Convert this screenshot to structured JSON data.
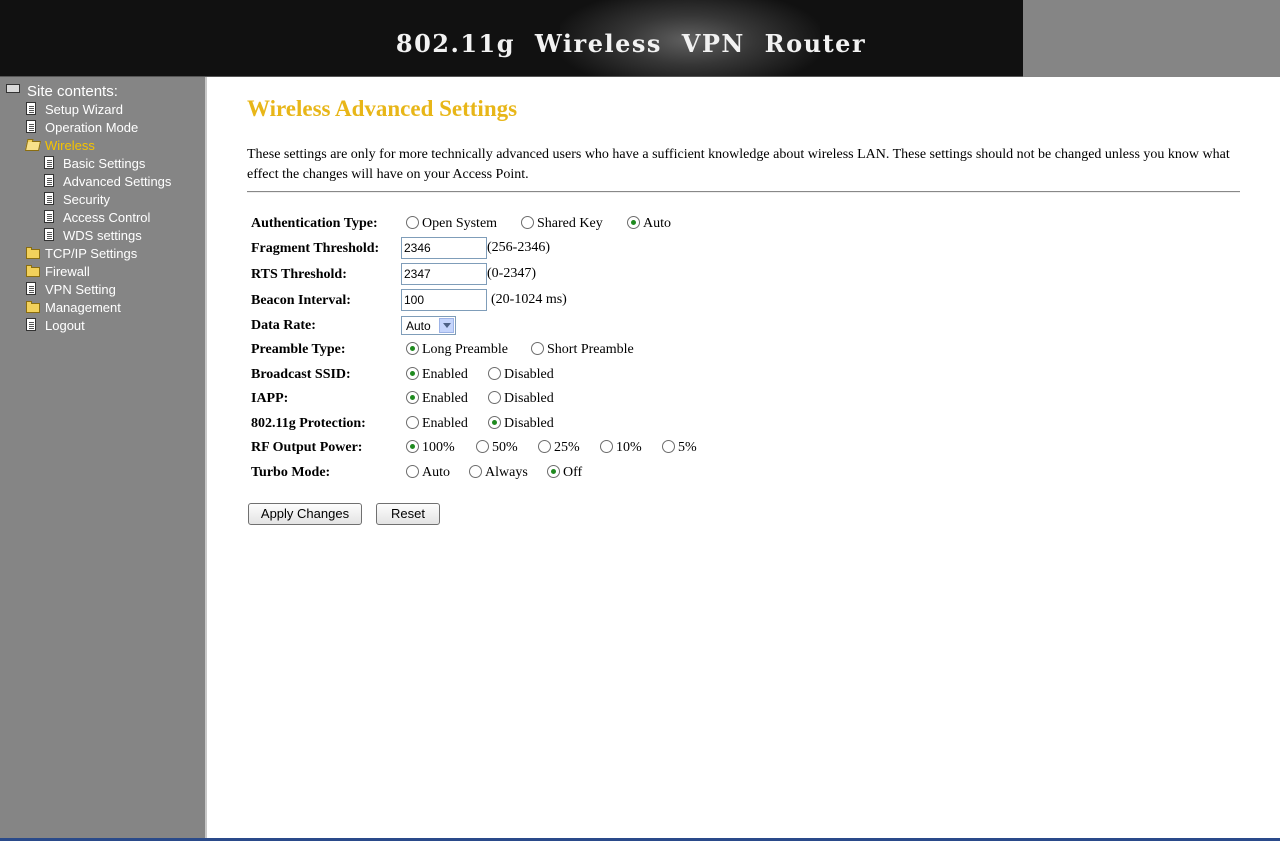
{
  "header": {
    "title": "802.11g  Wireless  VPN  Router"
  },
  "sidebar": {
    "heading": "Site contents:",
    "items": [
      {
        "label": "Setup Wizard",
        "icon": "document-icon"
      },
      {
        "label": "Operation Mode",
        "icon": "document-icon"
      },
      {
        "label": "Wireless",
        "icon": "folder-open-icon",
        "active": true
      },
      {
        "label": "Basic Settings",
        "icon": "document-icon"
      },
      {
        "label": "Advanced Settings",
        "icon": "document-icon"
      },
      {
        "label": "Security",
        "icon": "document-icon"
      },
      {
        "label": "Access Control",
        "icon": "document-icon"
      },
      {
        "label": "WDS settings",
        "icon": "document-icon"
      },
      {
        "label": "TCP/IP Settings",
        "icon": "folder-icon"
      },
      {
        "label": "Firewall",
        "icon": "folder-icon"
      },
      {
        "label": "VPN Setting",
        "icon": "document-icon"
      },
      {
        "label": "Management",
        "icon": "folder-icon"
      },
      {
        "label": "Logout",
        "icon": "document-icon"
      }
    ]
  },
  "main": {
    "title": "Wireless Advanced Settings",
    "description": "These settings are only for more technically advanced users who have a sufficient knowledge about wireless LAN. These settings should not be changed unless you know what effect the changes will have on your Access Point.",
    "form": {
      "auth_type": {
        "label": "Authentication Type:",
        "options": [
          "Open System",
          "Shared Key",
          "Auto"
        ],
        "selected": "Auto"
      },
      "fragment": {
        "label": "Fragment Threshold:",
        "value": "2346",
        "hint": "(256-2346)"
      },
      "rts": {
        "label": "RTS Threshold:",
        "value": "2347",
        "hint": "(0-2347)"
      },
      "beacon": {
        "label": "Beacon Interval:",
        "value": "100",
        "hint": "(20-1024 ms)"
      },
      "data_rate": {
        "label": "Data Rate:",
        "value": "Auto"
      },
      "preamble": {
        "label": "Preamble Type:",
        "options": [
          "Long Preamble",
          "Short Preamble"
        ],
        "selected": "Long Preamble"
      },
      "broadcast_ssid": {
        "label": "Broadcast SSID:",
        "options": [
          "Enabled",
          "Disabled"
        ],
        "selected": "Enabled"
      },
      "iapp": {
        "label": "IAPP:",
        "options": [
          "Enabled",
          "Disabled"
        ],
        "selected": "Enabled"
      },
      "protection": {
        "label": "802.11g Protection:",
        "options": [
          "Enabled",
          "Disabled"
        ],
        "selected": "Disabled"
      },
      "rf_power": {
        "label": "RF Output Power:",
        "options": [
          "100%",
          "50%",
          "25%",
          "10%",
          "5%"
        ],
        "selected": "100%"
      },
      "turbo": {
        "label": "Turbo Mode:",
        "options": [
          "Auto",
          "Always",
          "Off"
        ],
        "selected": "Off"
      }
    },
    "buttons": {
      "apply": "Apply Changes",
      "reset": "Reset"
    }
  },
  "colors": {
    "title": "#e8b618",
    "sidebar_bg": "#858585",
    "active_nav": "#f5c400",
    "banner_bg": "#111111"
  }
}
